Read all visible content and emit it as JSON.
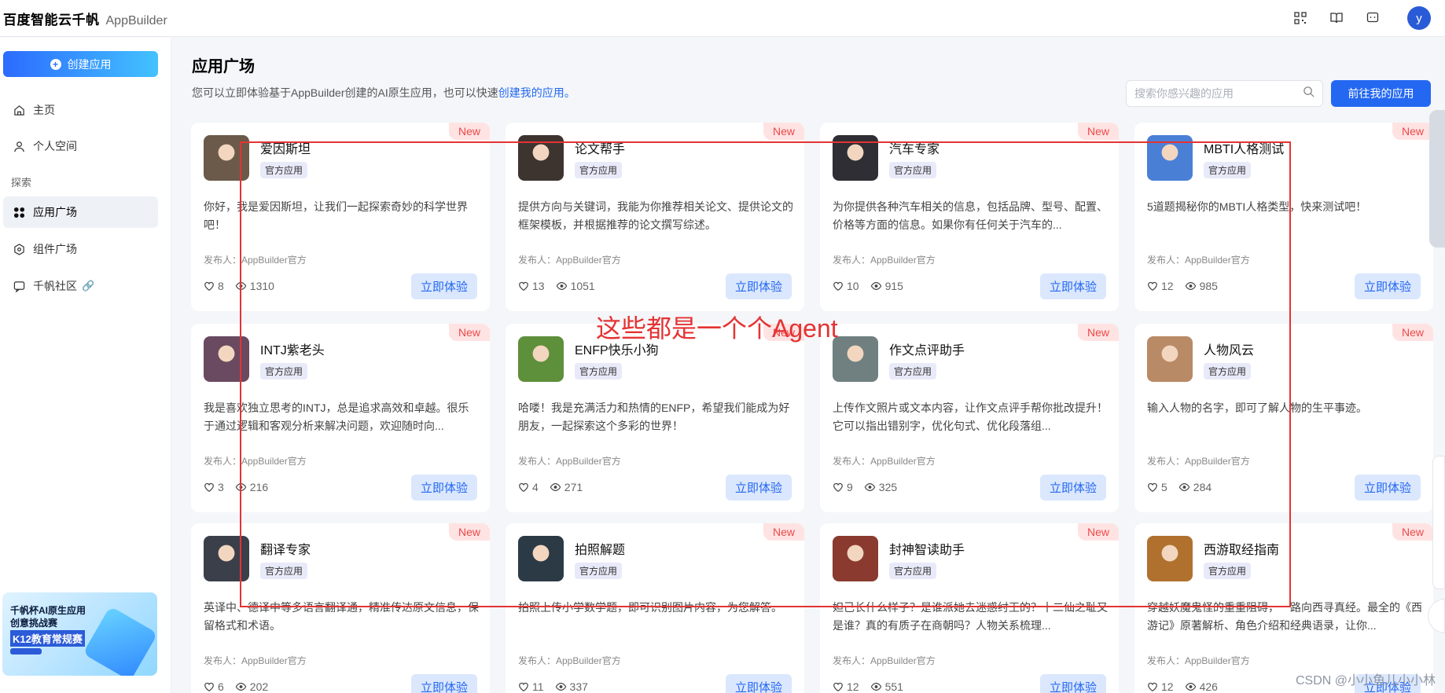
{
  "brand": {
    "logo": "百度智能云千帆",
    "product": "AppBuilder"
  },
  "top_icons": [
    "grid-icon",
    "book-icon",
    "feedback-icon"
  ],
  "user": {
    "avatar_letter": "y"
  },
  "sidebar": {
    "create_label": "创建应用",
    "items": [
      {
        "label": "主页",
        "icon": "home-icon"
      },
      {
        "label": "个人空间",
        "icon": "user-icon"
      }
    ],
    "section": "探索",
    "explore_items": [
      {
        "label": "应用广场",
        "icon": "apps-icon",
        "active": true
      },
      {
        "label": "组件广场",
        "icon": "component-icon"
      },
      {
        "label": "千帆社区",
        "icon": "community-icon"
      }
    ],
    "promo": {
      "line1": "千帆杯AI原生应用",
      "line2": "创意挑战赛",
      "line3": "K12教育常规赛"
    }
  },
  "main": {
    "title": "应用广场",
    "subtitle": "您可以立即体验基于AppBuilder创建的AI原生应用，也可以快速",
    "subtitle_link": "创建我的应用。",
    "search_placeholder": "搜索你感兴趣的应用",
    "goto_label": "前往我的应用"
  },
  "common": {
    "new_tag": "New",
    "badge": "官方应用",
    "try_label": "立即体验"
  },
  "cards": [
    {
      "name": "爱因斯坦",
      "desc": "你好，我是爱因斯坦，让我们一起探索奇妙的科学世界吧！",
      "publisher": "发布人：AppBuilder官方",
      "likes": "8",
      "views": "1310",
      "color": "#6b5a4a"
    },
    {
      "name": "论文帮手",
      "desc": "提供方向与关键词，我能为你推荐相关论文、提供论文的框架模板，并根据推荐的论文撰写综述。",
      "publisher": "发布人：AppBuilder官方",
      "likes": "13",
      "views": "1051",
      "color": "#3d3430"
    },
    {
      "name": "汽车专家",
      "desc": "为你提供各种汽车相关的信息，包括品牌、型号、配置、价格等方面的信息。如果你有任何关于汽车的...",
      "publisher": "发布人：AppBuilder官方",
      "likes": "10",
      "views": "915",
      "color": "#2e2e34"
    },
    {
      "name": "MBTI人格测试",
      "desc": "5道题揭秘你的MBTI人格类型，快来测试吧！",
      "publisher": "发布人：AppBuilder官方",
      "likes": "12",
      "views": "985",
      "color": "#4a7fd6"
    },
    {
      "name": "INTJ紫老头",
      "desc": "我是喜欢独立思考的INTJ，总是追求高效和卓越。很乐于通过逻辑和客观分析来解决问题，欢迎随时向...",
      "publisher": "发布人：AppBuilder官方",
      "likes": "3",
      "views": "216",
      "color": "#6a4a60"
    },
    {
      "name": "ENFP快乐小狗",
      "desc": "哈喽！我是充满活力和热情的ENFP，希望我们能成为好朋友，一起探索这个多彩的世界！",
      "publisher": "发布人：AppBuilder官方",
      "likes": "4",
      "views": "271",
      "color": "#5e8f3a"
    },
    {
      "name": "作文点评助手",
      "desc": "上传作文照片或文本内容，让作文点评手帮你批改提升！它可以指出错别字，优化句式、优化段落组...",
      "publisher": "发布人：AppBuilder官方",
      "likes": "9",
      "views": "325",
      "color": "#708080"
    },
    {
      "name": "人物风云",
      "desc": "输入人物的名字，即可了解人物的生平事迹。",
      "publisher": "发布人：AppBuilder官方",
      "likes": "5",
      "views": "284",
      "color": "#b98a66"
    },
    {
      "name": "翻译专家",
      "desc": "英译中、德译中等多语言翻译通，精准传达原文信息，保留格式和术语。",
      "publisher": "发布人：AppBuilder官方",
      "likes": "6",
      "views": "202",
      "color": "#3b3f4a"
    },
    {
      "name": "拍照解题",
      "desc": "拍照上传小学数学题，即可识别图片内容，为您解答。",
      "publisher": "发布人：AppBuilder官方",
      "likes": "11",
      "views": "337",
      "color": "#2c3a46"
    },
    {
      "name": "封神智读助手",
      "desc": "妲己长什么样子？是谁派她去迷惑纣王的？十二仙之耻又是谁？真的有质子在商朝吗？人物关系梳理...",
      "publisher": "发布人：AppBuilder官方",
      "likes": "12",
      "views": "551",
      "color": "#8a3a2e"
    },
    {
      "name": "西游取经指南",
      "desc": "穿越妖魔鬼怪的重重阻碍，一路向西寻真经。最全的《西游记》原著解析、角色介绍和经典语录，让你...",
      "publisher": "发布人：AppBuilder官方",
      "likes": "12",
      "views": "426",
      "color": "#b0712e"
    }
  ],
  "annotation": "这些都是一个个Agent",
  "watermark": "CSDN @小小鱼儿小小林"
}
